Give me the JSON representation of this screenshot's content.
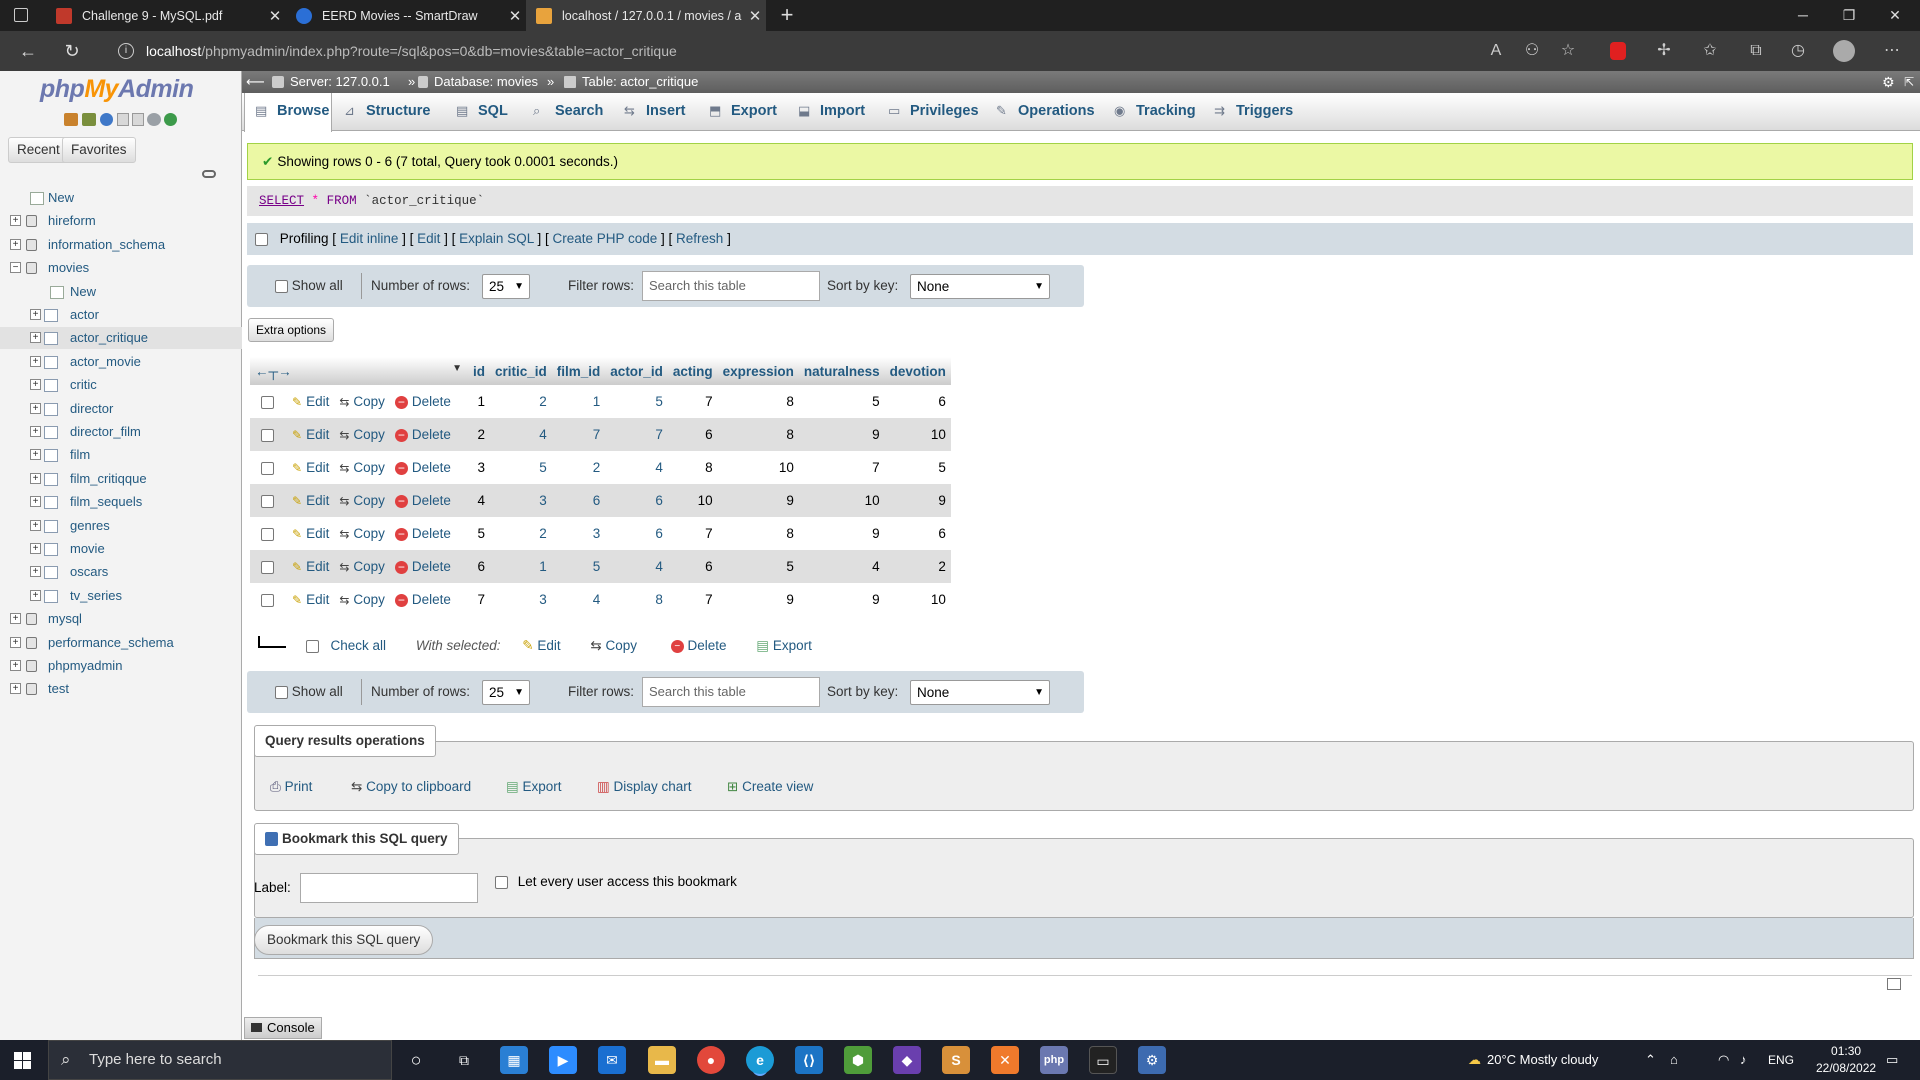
{
  "browser": {
    "tabs": [
      {
        "title": "Challenge 9 - MySQL.pdf",
        "favicon_color": "#c0392b"
      },
      {
        "title": "EERD Movies -- SmartDraw",
        "favicon_color": "#2b6fd6"
      },
      {
        "title": "localhost / 127.0.0.1 / movies / a",
        "favicon_color": "#e8a33d"
      }
    ],
    "new_tab": "+",
    "url_host": "localhost",
    "url_path": "/phpmyadmin/index.php?route=/sql&pos=0&db=movies&table=actor_critique"
  },
  "sidebar": {
    "logo_php": "php",
    "logo_my": "My",
    "logo_admin": "Admin",
    "recent_label": "Recent",
    "favorites_label": "Favorites",
    "tree": [
      {
        "label": "New",
        "level": 0,
        "kind": "new"
      },
      {
        "label": "hireform",
        "level": 0,
        "kind": "db"
      },
      {
        "label": "information_schema",
        "level": 0,
        "kind": "db"
      },
      {
        "label": "movies",
        "level": 0,
        "kind": "db-open"
      },
      {
        "label": "New",
        "level": 1,
        "kind": "new"
      },
      {
        "label": "actor",
        "level": 1,
        "kind": "table"
      },
      {
        "label": "actor_critique",
        "level": 1,
        "kind": "table",
        "selected": true
      },
      {
        "label": "actor_movie",
        "level": 1,
        "kind": "table"
      },
      {
        "label": "critic",
        "level": 1,
        "kind": "table"
      },
      {
        "label": "director",
        "level": 1,
        "kind": "table"
      },
      {
        "label": "director_film",
        "level": 1,
        "kind": "table"
      },
      {
        "label": "film",
        "level": 1,
        "kind": "table"
      },
      {
        "label": "film_critiqque",
        "level": 1,
        "kind": "table"
      },
      {
        "label": "film_sequels",
        "level": 1,
        "kind": "table"
      },
      {
        "label": "genres",
        "level": 1,
        "kind": "table"
      },
      {
        "label": "movie",
        "level": 1,
        "kind": "table"
      },
      {
        "label": "oscars",
        "level": 1,
        "kind": "table"
      },
      {
        "label": "tv_series",
        "level": 1,
        "kind": "table"
      },
      {
        "label": "mysql",
        "level": 0,
        "kind": "db"
      },
      {
        "label": "performance_schema",
        "level": 0,
        "kind": "db"
      },
      {
        "label": "phpmyadmin",
        "level": 0,
        "kind": "db"
      },
      {
        "label": "test",
        "level": 0,
        "kind": "db"
      }
    ]
  },
  "breadcrumb": {
    "server": "Server: 127.0.0.1",
    "database": "Database: movies",
    "table": "Table: actor_critique",
    "sep": "»"
  },
  "menu_tabs": [
    "Browse",
    "Structure",
    "SQL",
    "Search",
    "Insert",
    "Export",
    "Import",
    "Privileges",
    "Operations",
    "Tracking",
    "Triggers"
  ],
  "message": {
    "success": "Showing rows 0 - 6 (7 total, Query took 0.0001 seconds.)",
    "sql_select": "SELECT",
    "sql_star": "*",
    "sql_from": "FROM",
    "sql_table": "`actor_critique`"
  },
  "profiling": {
    "label": "Profiling",
    "links": [
      "Edit inline",
      "Edit",
      "Explain SQL",
      "Create PHP code",
      "Refresh"
    ]
  },
  "navbar": {
    "show_all": "Show all",
    "rows_label": "Number of rows:",
    "rows_value": "25",
    "filter_label": "Filter rows:",
    "filter_placeholder": "Search this table",
    "sort_label": "Sort by key:",
    "sort_value": "None"
  },
  "extra_options": "Extra options",
  "table": {
    "columns": [
      "id",
      "critic_id",
      "film_id",
      "actor_id",
      "acting",
      "expression",
      "naturalness",
      "devotion"
    ],
    "actions": {
      "edit": "Edit",
      "copy": "Copy",
      "delete": "Delete"
    },
    "rows": [
      [
        1,
        2,
        1,
        5,
        7,
        8,
        5,
        6
      ],
      [
        2,
        4,
        7,
        7,
        6,
        8,
        9,
        10
      ],
      [
        3,
        5,
        2,
        4,
        8,
        10,
        7,
        5
      ],
      [
        4,
        3,
        6,
        6,
        10,
        9,
        10,
        9
      ],
      [
        5,
        2,
        3,
        6,
        7,
        8,
        9,
        6
      ],
      [
        6,
        1,
        5,
        4,
        6,
        5,
        4,
        2
      ],
      [
        7,
        3,
        4,
        8,
        7,
        9,
        9,
        10
      ]
    ]
  },
  "with_selected": {
    "check_all": "Check all",
    "label": "With selected:",
    "edit": "Edit",
    "copy": "Copy",
    "delete": "Delete",
    "export": "Export"
  },
  "query_ops": {
    "legend": "Query results operations",
    "print": "Print",
    "copy_clipboard": "Copy to clipboard",
    "export": "Export",
    "display_chart": "Display chart",
    "create_view": "Create view"
  },
  "bookmark": {
    "legend": "Bookmark this SQL query",
    "label": "Label:",
    "checkbox_label": "Let every user access this bookmark",
    "button": "Bookmark this SQL query"
  },
  "console": "Console",
  "taskbar": {
    "search_placeholder": "Type here to search",
    "weather": "20°C  Mostly cloudy",
    "lang": "ENG",
    "time": "01:30",
    "date": "22/08/2022"
  }
}
